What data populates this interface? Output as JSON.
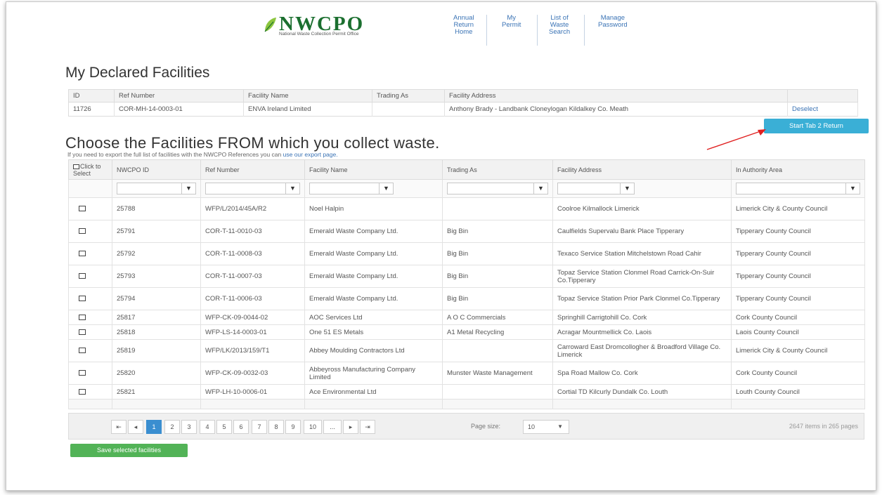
{
  "header": {
    "logo_text": "NWCPO",
    "logo_subtitle": "National Waste Collection Permit Office",
    "nav": [
      {
        "label_lines": [
          "Annual",
          "Return",
          "Home"
        ]
      },
      {
        "label_lines": [
          "My",
          "Permit"
        ]
      },
      {
        "label_lines": [
          "List of",
          "Waste",
          "Search"
        ]
      },
      {
        "label_lines": [
          "Manage",
          "Password"
        ]
      }
    ]
  },
  "declared": {
    "title": "My Declared Facilities",
    "columns": [
      "ID",
      "Ref Number",
      "Facility Name",
      "Trading As",
      "Facility Address",
      ""
    ],
    "row": {
      "id": "11726",
      "ref": "COR-MH-14-0003-01",
      "name": "ENVA Ireland Limited",
      "trading_as": "",
      "address": "Anthony Brady - Landbank Cloneylogan Kildalkey Co. Meath",
      "action": "Deselect"
    }
  },
  "start_button": "Start Tab 2 Return",
  "choose": {
    "title": "Choose the Facilities FROM which you collect waste.",
    "help_prefix": "If you need to export the full list of facilities with the NWCPO References you can ",
    "help_link": "use our export page."
  },
  "grid": {
    "columns": [
      "Click to Select",
      "NWCPO ID",
      "Ref Number",
      "Facility Name",
      "Trading As",
      "Facility Address",
      "In Authority Area"
    ],
    "rows": [
      {
        "id": "25788",
        "ref": "WFP/L/2014/45A/R2",
        "name": "Noel Halpin",
        "trading": "",
        "address": "Coolroe Kilmallock Limerick",
        "area": "Limerick City & County Council"
      },
      {
        "id": "25791",
        "ref": "COR-T-11-0010-03",
        "name": "Emerald Waste Company Ltd.",
        "trading": "Big Bin",
        "address": "Caulfields Supervalu Bank Place Tipperary",
        "area": "Tipperary County Council"
      },
      {
        "id": "25792",
        "ref": "COR-T-11-0008-03",
        "name": "Emerald Waste Company Ltd.",
        "trading": "Big Bin",
        "address": "Texaco Service Station Mitchelstown Road Cahir",
        "area": "Tipperary County Council"
      },
      {
        "id": "25793",
        "ref": "COR-T-11-0007-03",
        "name": "Emerald Waste Company Ltd.",
        "trading": "Big Bin",
        "address": "Topaz Service Station Clonmel Road Carrick-On-Suir Co.Tipperary",
        "area": "Tipperary County Council"
      },
      {
        "id": "25794",
        "ref": "COR-T-11-0006-03",
        "name": "Emerald Waste Company Ltd.",
        "trading": "Big Bin",
        "address": "Topaz Service Station Prior Park Clonmel Co.Tipperary",
        "area": "Tipperary County Council"
      },
      {
        "id": "25817",
        "ref": "WFP-CK-09-0044-02",
        "name": "AOC Services Ltd",
        "trading": "A O C Commercials",
        "address": "Springhill Carrigtohill Co. Cork",
        "area": "Cork County Council"
      },
      {
        "id": "25818",
        "ref": "WFP-LS-14-0003-01",
        "name": "One 51 ES Metals",
        "trading": "A1 Metal Recycling",
        "address": "Acragar Mountmellick Co. Laois",
        "area": "Laois County Council"
      },
      {
        "id": "25819",
        "ref": "WFP/LK/2013/159/T1",
        "name": "Abbey Moulding Contractors Ltd",
        "trading": "",
        "address": "Carroward East Dromcollogher & Broadford Village Co. Limerick",
        "area": "Limerick City & County Council"
      },
      {
        "id": "25820",
        "ref": "WFP-CK-09-0032-03",
        "name": "Abbeyross Manufacturing Company Limited",
        "trading": "Munster Waste Management",
        "address": "Spa Road Mallow Co. Cork",
        "area": "Cork County Council"
      },
      {
        "id": "25821",
        "ref": "WFP-LH-10-0006-01",
        "name": "Ace Environmental Ltd",
        "trading": "",
        "address": "Cortial TD Kilcurly Dundalk Co. Louth",
        "area": "Louth County Council"
      }
    ]
  },
  "pager": {
    "first": "⇤",
    "prev": "◂",
    "next": "▸",
    "last": "⇥",
    "pages": [
      "1",
      "2",
      "3",
      "4",
      "5",
      "6",
      "7",
      "8",
      "9",
      "10",
      "..."
    ],
    "active_page": "1",
    "page_size_label": "Page size:",
    "page_size": "10",
    "info": "2647 items in 265 pages"
  },
  "save_button": "Save selected facilities",
  "colors": {
    "accent": "#3aafd6",
    "save": "#52b357",
    "page_active": "#3a8ed0",
    "logo": "#1b6f2f",
    "link": "#3a73b5"
  }
}
